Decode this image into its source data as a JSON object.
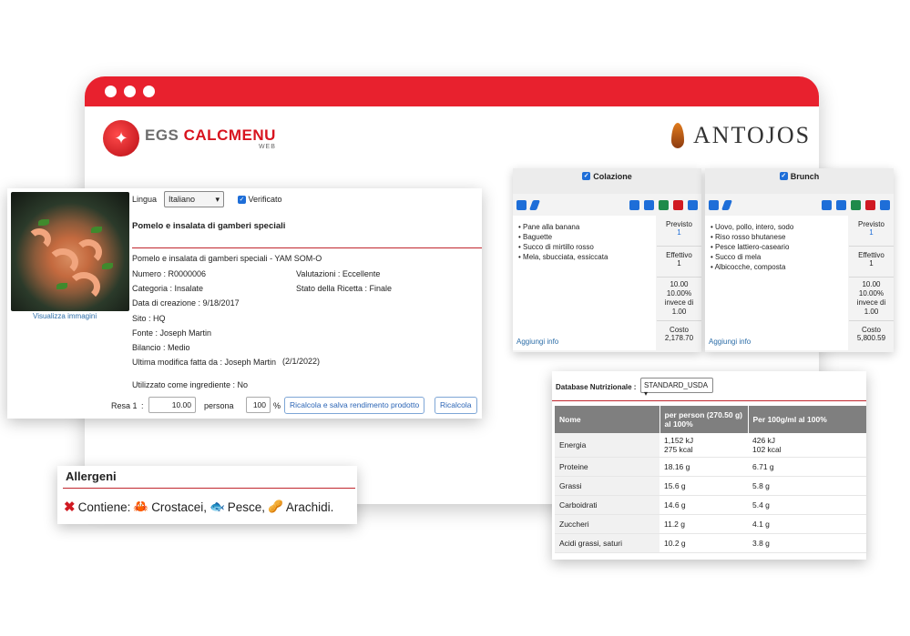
{
  "brand": {
    "egs_logo_gray": "EGS ",
    "egs_logo_red": "CALCMENU",
    "egs_logo_sub": "WEB",
    "client_logo": "ANTOJOS"
  },
  "recipe": {
    "view_images": "Visualizza immagini",
    "language_label": "Lingua",
    "language_value": "Italiano",
    "verified_label": "Verificato",
    "title": "Pomelo e insalata di gamberi speciali",
    "subtitle": "Pomelo e insalata di gamberi speciali - YAM SOM-O",
    "number": "Numero : R0000006",
    "rating": "Valutazioni : Eccellente",
    "category": "Categoria : Insalate",
    "status": "Stato della Ricetta : Finale",
    "created": "Data di creazione : 9/18/2017",
    "site": "Sito : HQ",
    "source": "Fonte : Joseph Martin",
    "budget": "Bilancio : Medio",
    "last_modified": "Ultima modifica fatta da : Joseph Martin",
    "last_modified_date": "(2/1/2022)",
    "used_as_ingredient": "Utilizzato come ingrediente : No",
    "yield_label": "Resa 1",
    "yield_colon": ":",
    "yield_value": "10.00",
    "yield_unit": "persona",
    "percent_value": "100",
    "percent_sign": "%",
    "btn_recalc_save": "Ricalcola e salva rendimento prodotto",
    "btn_recalc": "Ricalcola"
  },
  "allergens": {
    "title": "Allergeni",
    "contains_label": "Contiene:",
    "items": [
      "Crostacei,",
      "Pesce,",
      "Arachidi."
    ]
  },
  "meals": [
    {
      "name": "Colazione",
      "items": [
        "• Pane alla banana",
        "• Baguette",
        "• Succo di mirtillo rosso",
        "• Mela, sbucciata, essiccata"
      ],
      "planned_label": "Previsto",
      "planned_value": "1",
      "actual_label": "Effettivo",
      "actual_value": "1",
      "ratio_1": "10.00",
      "ratio_2": "10.00%",
      "ratio_3": "invece di",
      "ratio_4": "1.00",
      "cost_label": "Costo",
      "cost_value": "2,178.70",
      "add_info": "Aggiungi info"
    },
    {
      "name": "Brunch",
      "items": [
        "• Uovo, pollo, intero, sodo",
        "• Riso rosso bhutanese",
        "• Pesce lattiero-caseario",
        "• Succo di mela",
        "• Albicocche, composta"
      ],
      "planned_label": "Previsto",
      "planned_value": "1",
      "actual_label": "Effettivo",
      "actual_value": "1",
      "ratio_1": "10.00",
      "ratio_2": "10.00%",
      "ratio_3": "invece di",
      "ratio_4": "1.00",
      "cost_label": "Costo",
      "cost_value": "5,800.59",
      "add_info": "Aggiungi info"
    }
  ],
  "nutrition": {
    "db_label": "Database Nutrizionale :",
    "db_value": "STANDARD_USDA",
    "headers": [
      "Nome",
      "per person (270.50 g) al 100%",
      "Per 100g/ml al 100%"
    ],
    "rows": [
      {
        "name": "Energia",
        "per_person": "1,152 kJ\n275 kcal",
        "per_100": "426 kJ\n102 kcal"
      },
      {
        "name": "Proteine",
        "per_person": "18.16 g",
        "per_100": "6.71 g"
      },
      {
        "name": "Grassi",
        "per_person": "15.6 g",
        "per_100": "5.8 g"
      },
      {
        "name": "Carboidrati",
        "per_person": "14.6 g",
        "per_100": "5.4 g"
      },
      {
        "name": "Zuccheri",
        "per_person": "11.2 g",
        "per_100": "4.1 g"
      },
      {
        "name": "Acidi grassi, saturi",
        "per_person": "10.2 g",
        "per_100": "3.8 g"
      }
    ]
  },
  "colors": {
    "brand_red": "#e8212e",
    "link_blue": "#2d6ea8",
    "tool_blue": "#1e6ed8",
    "tool_green": "#1e8a4a",
    "tool_red": "#d01a22"
  }
}
